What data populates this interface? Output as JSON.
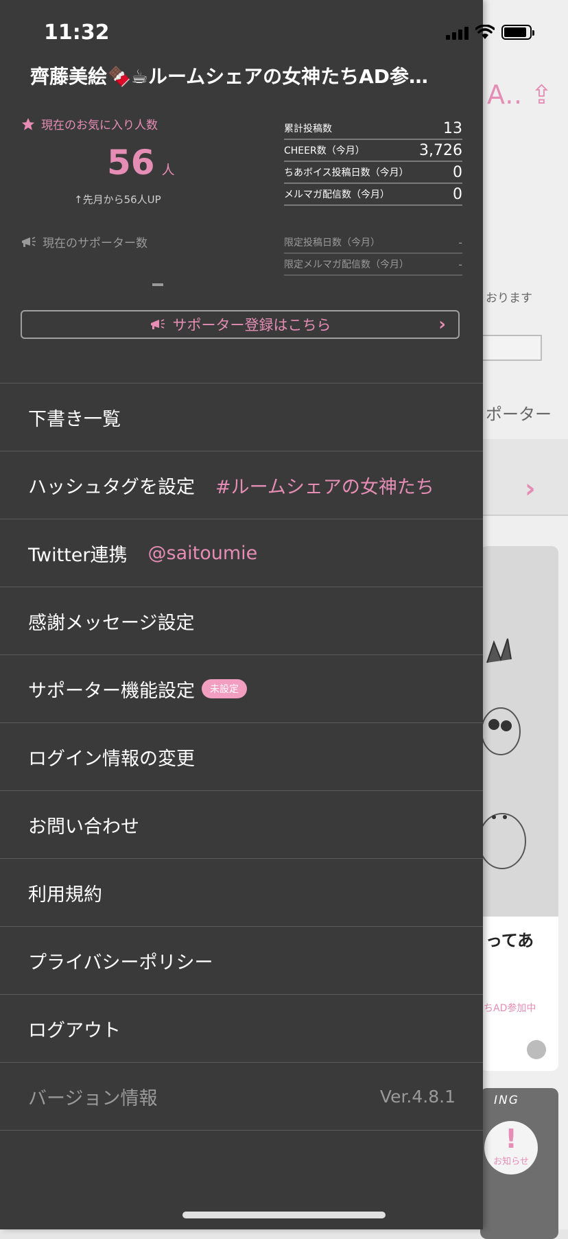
{
  "status": {
    "time": "11:32"
  },
  "background": {
    "header_text": "A‥",
    "notice_text": "おります",
    "supporter_text": "ポーター",
    "card_title": "ってあ",
    "card_tag": "ちAD参加中",
    "card2_label": "ING",
    "notice_fab": {
      "mark": "!",
      "label": "お知らせ"
    }
  },
  "drawer": {
    "title": "齊藤美絵🍫☕ルームシェアの女神たちAD参…",
    "favorites": {
      "label": "現在のお気に入り人数",
      "count": "56",
      "unit": "人",
      "change": "↑先月から56人UP"
    },
    "supporters": {
      "label": "現在のサポーター数",
      "value": "-"
    },
    "stats": [
      {
        "key": "累計投稿数",
        "value": "13"
      },
      {
        "key": "CHEER数（今月）",
        "value": "3,726"
      },
      {
        "key": "ちあボイス投稿日数（今月）",
        "value": "0"
      },
      {
        "key": "メルマガ配信数（今月）",
        "value": "0"
      }
    ],
    "limited_stats": [
      {
        "key": "限定投稿日数（今月）",
        "value": "-"
      },
      {
        "key": "限定メルマガ配信数（今月）",
        "value": "-"
      }
    ],
    "supporter_button": "サポーター登録はこちら",
    "menu": {
      "drafts": "下書き一覧",
      "hashtag": "ハッシュタグを設定",
      "hashtag_value": "#ルームシェアの女神たち",
      "twitter": "Twitter連携",
      "twitter_value": "@saitoumie",
      "thanks": "感謝メッセージ設定",
      "supporter_settings": "サポーター機能設定",
      "supporter_badge": "未設定",
      "login": "ログイン情報の変更",
      "contact": "お問い合わせ",
      "terms": "利用規約",
      "privacy": "プライバシーポリシー",
      "logout": "ログアウト",
      "version_label": "バージョン情報",
      "version_value": "Ver.4.8.1"
    }
  },
  "colors": {
    "accent": "#e58db4",
    "drawer_bg": "#3a3a3a"
  },
  "icons": [
    "star-icon",
    "megaphone-icon",
    "chevron-right-icon",
    "share-icon",
    "signal-icon",
    "wifi-icon",
    "battery-icon"
  ]
}
